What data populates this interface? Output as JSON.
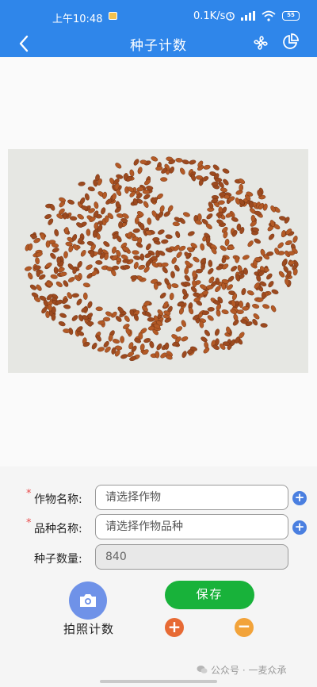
{
  "status_bar": {
    "time": "上午10:48",
    "network_speed": "0.1K/s",
    "battery": "55"
  },
  "header": {
    "title": "种子计数",
    "back_icon": "chevron-left-icon",
    "action_icons": [
      "fan-icon",
      "pie-chart-icon"
    ]
  },
  "form": {
    "crop": {
      "label": "作物名称:",
      "placeholder": "请选择作物",
      "required": "*"
    },
    "variety": {
      "label": "品种名称:",
      "placeholder": "请选择作物品种",
      "required": "*"
    },
    "seed_count": {
      "label": "种子数量:",
      "value": "840"
    }
  },
  "actions": {
    "camera_label": "拍照计数",
    "save_label": "保存",
    "plus": "+",
    "minus": "−",
    "add": "+"
  },
  "watermark": "公众号 · 一麦众承",
  "colors": {
    "primary": "#2f86ea",
    "save": "#18b23a",
    "plus": "#e76a34",
    "minus": "#f2a33a",
    "required": "#e94b4b",
    "seed": "#9c4a1f"
  }
}
